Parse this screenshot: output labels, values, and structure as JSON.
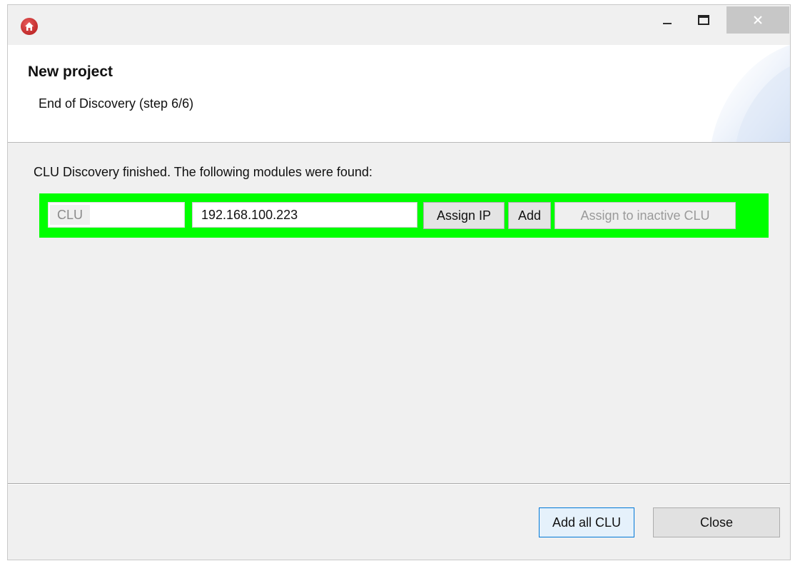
{
  "window": {
    "icon": "home-icon",
    "controls": {
      "minimize": "minimize-icon",
      "maximize": "maximize-icon",
      "close": "close-icon"
    }
  },
  "header": {
    "title": "New project",
    "subtitle": "End of Discovery (step 6/6)"
  },
  "content": {
    "message": "CLU Discovery finished. The following modules were found:",
    "modules": [
      {
        "name_placeholder": "CLU",
        "ip": "192.168.100.223",
        "assign_ip_label": "Assign IP",
        "add_label": "Add",
        "assign_inactive_label": "Assign to inactive CLU",
        "row_color": "#00ff00"
      }
    ]
  },
  "footer": {
    "add_all_label": "Add all CLU",
    "close_label": "Close"
  },
  "colors": {
    "accent_focus": "#0078d7",
    "icon_red": "#c62828",
    "row_highlight": "#00ff00"
  }
}
